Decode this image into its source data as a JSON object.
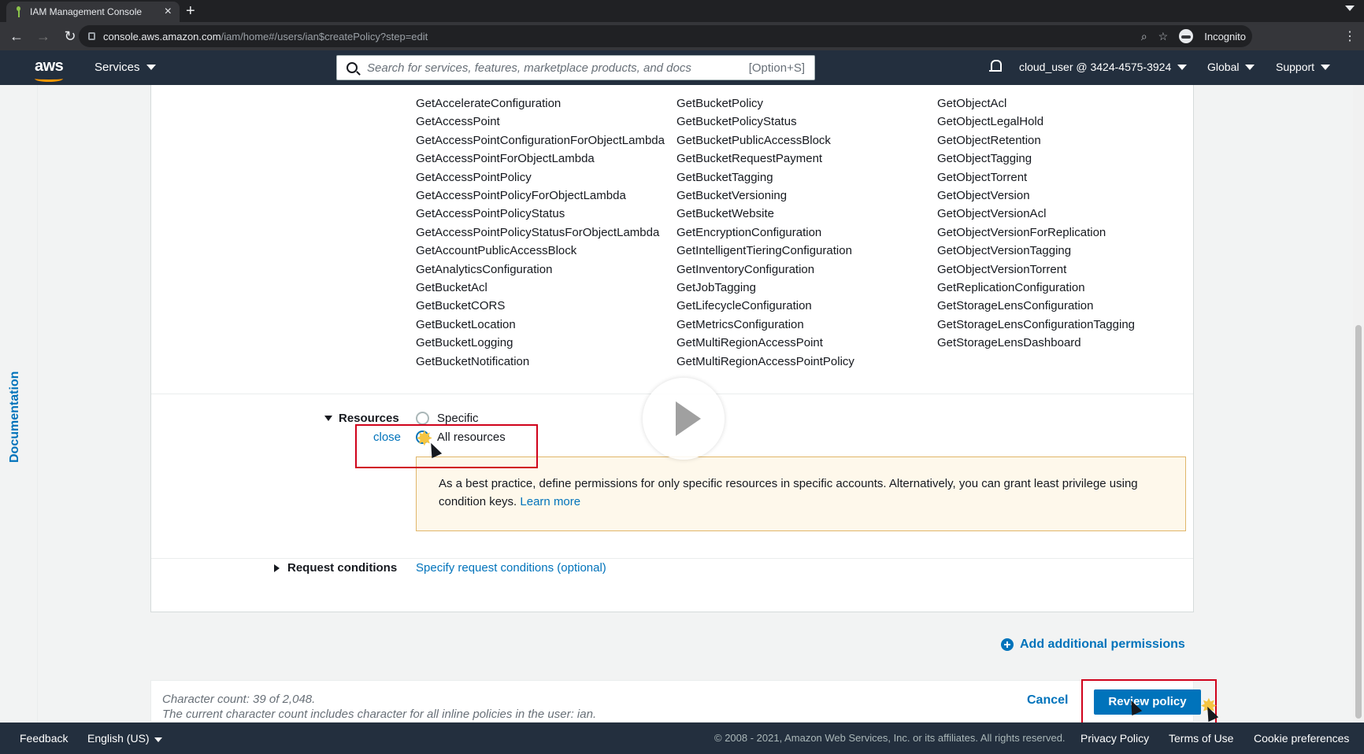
{
  "browser": {
    "tab_title": "IAM Management Console",
    "tab_close": "×",
    "new_tab": "+",
    "url_host": "console.aws.amazon.com",
    "url_path": "/iam/home#/users/ian$createPolicy?step=edit",
    "profile_label": "Incognito"
  },
  "aws_nav": {
    "logo": "aws",
    "services_label": "Services",
    "search_placeholder": "Search for services, features, marketplace products, and docs",
    "search_shortcut": "[Option+S]",
    "account": "cloud_user @ 3424-4575-3924",
    "region": "Global",
    "support": "Support"
  },
  "sidebar": {
    "documentation": "Documentation"
  },
  "actions": {
    "col1": [
      "GetAccelerateConfiguration",
      "GetAccessPoint",
      "GetAccessPointConfigurationForObjectLambda",
      "GetAccessPointForObjectLambda",
      "GetAccessPointPolicy",
      "GetAccessPointPolicyForObjectLambda",
      "GetAccessPointPolicyStatus",
      "GetAccessPointPolicyStatusForObjectLambda",
      "GetAccountPublicAccessBlock",
      "GetAnalyticsConfiguration",
      "GetBucketAcl",
      "GetBucketCORS",
      "GetBucketLocation",
      "GetBucketLogging",
      "GetBucketNotification"
    ],
    "col2": [
      "GetBucketPolicy",
      "GetBucketPolicyStatus",
      "GetBucketPublicAccessBlock",
      "GetBucketRequestPayment",
      "GetBucketTagging",
      "GetBucketVersioning",
      "GetBucketWebsite",
      "GetEncryptionConfiguration",
      "GetIntelligentTieringConfiguration",
      "GetInventoryConfiguration",
      "GetJobTagging",
      "GetLifecycleConfiguration",
      "GetMetricsConfiguration",
      "GetMultiRegionAccessPoint",
      "GetMultiRegionAccessPointPolicy"
    ],
    "col3": [
      "GetObjectAcl",
      "GetObjectLegalHold",
      "GetObjectRetention",
      "GetObjectTagging",
      "GetObjectTorrent",
      "GetObjectVersion",
      "GetObjectVersionAcl",
      "GetObjectVersionForReplication",
      "GetObjectVersionTagging",
      "GetObjectVersionTorrent",
      "GetReplicationConfiguration",
      "GetStorageLensConfiguration",
      "GetStorageLensConfigurationTagging",
      "GetStorageLensDashboard"
    ]
  },
  "resources": {
    "label": "Resources",
    "close": "close",
    "option_specific": "Specific",
    "option_all": "All resources",
    "selected": "All resources",
    "warning_text": "As a best practice, define permissions for only specific resources in specific accounts. Alternatively, you can grant least privilege using condition keys.",
    "learn_more": "Learn more"
  },
  "request_conditions": {
    "label": "Request conditions",
    "link": "Specify request conditions (optional)"
  },
  "add_permissions": "Add additional permissions",
  "footer_bar": {
    "charcount_line1": "Character count: 39 of 2,048.",
    "charcount_line2": "The current character count includes character for all inline policies in the user: ian.",
    "cancel": "Cancel",
    "review": "Review policy"
  },
  "console_footer": {
    "feedback": "Feedback",
    "language": "English (US)",
    "copyright": "© 2008 - 2021, Amazon Web Services, Inc. or its affiliates. All rights reserved.",
    "privacy": "Privacy Policy",
    "terms": "Terms of Use",
    "cookies": "Cookie preferences"
  },
  "colors": {
    "aws_nav_bg": "#232f3e",
    "link_blue": "#0073bb",
    "aws_orange": "#ff9900",
    "highlight_red": "#d0021b"
  }
}
